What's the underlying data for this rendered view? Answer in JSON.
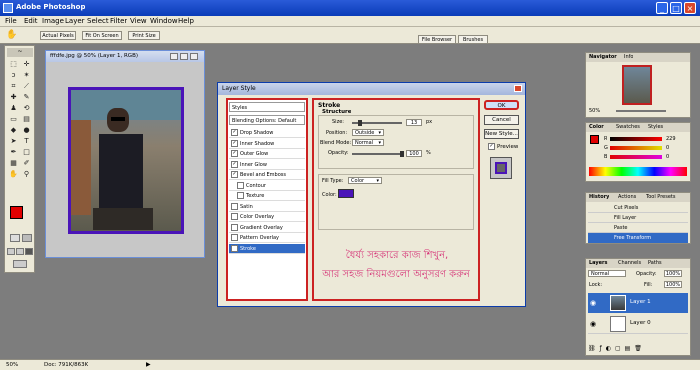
{
  "app": {
    "title": "Adobe Photoshop"
  },
  "menu": [
    "File",
    "Edit",
    "Image",
    "Layer",
    "Select",
    "Filter",
    "View",
    "Window",
    "Help"
  ],
  "options": {
    "buttons": [
      "Actual Pixels",
      "Fit On Screen",
      "Print Size"
    ],
    "right_tabs": [
      "File Browser",
      "Brushes"
    ]
  },
  "document": {
    "title": "fffdfe.jpg @ 50% (Layer 1, RGB)"
  },
  "dialog": {
    "title": "Layer Style",
    "styles_header": "Styles",
    "blending": "Blending Options: Default",
    "effects": [
      {
        "label": "Drop Shadow",
        "checked": true
      },
      {
        "label": "Inner Shadow",
        "checked": true
      },
      {
        "label": "Outer Glow",
        "checked": true
      },
      {
        "label": "Inner Glow",
        "checked": true
      },
      {
        "label": "Bevel and Emboss",
        "checked": true
      },
      {
        "label": "Contour",
        "checked": false
      },
      {
        "label": "Texture",
        "checked": false
      },
      {
        "label": "Satin",
        "checked": false
      },
      {
        "label": "Color Overlay",
        "checked": false
      },
      {
        "label": "Gradient Overlay",
        "checked": false
      },
      {
        "label": "Pattern Overlay",
        "checked": false
      },
      {
        "label": "Stroke",
        "checked": true
      }
    ],
    "stroke": {
      "heading": "Stroke",
      "structure": "Structure",
      "size_label": "Size:",
      "size_value": "13",
      "size_unit": "px",
      "position_label": "Position:",
      "position_value": "Outside",
      "blend_label": "Blend Mode:",
      "blend_value": "Normal",
      "opacity_label": "Opacity:",
      "opacity_value": "100",
      "opacity_unit": "%",
      "fill_type_label": "Fill Type:",
      "fill_type_value": "Color",
      "color_label": "Color:",
      "color_hex": "#4a14b8"
    },
    "buttons": {
      "ok": "OK",
      "cancel": "Cancel",
      "new_style": "New Style...",
      "preview": "Preview"
    },
    "bengali_line1": "ধৈর্য্য সহকারে কাজ শিখুন,",
    "bengali_line2": "আর সহজ নিয়মগুলো অনুসরণ করুন"
  },
  "navigator": {
    "tabs": [
      "Navigator",
      "Info"
    ],
    "zoom": "50%"
  },
  "color_panel": {
    "tabs": [
      "Color",
      "Swatches",
      "Styles"
    ],
    "r_label": "R",
    "g_label": "G",
    "b_label": "B",
    "r": "229",
    "g": "0",
    "b": "0"
  },
  "history": {
    "tabs": [
      "History",
      "Actions",
      "Tool Presets"
    ],
    "items": [
      "Cut Pixels",
      "Fill Layer",
      "Paste",
      "Free Transform"
    ]
  },
  "layers": {
    "tabs": [
      "Layers",
      "Channels",
      "Paths"
    ],
    "mode": "Normal",
    "opacity_label": "Opacity:",
    "opacity": "100%",
    "lock_label": "Lock:",
    "fill_label": "Fill:",
    "fill": "100%",
    "items": [
      "Layer 1",
      "Layer 0"
    ]
  },
  "status": {
    "zoom": "50%",
    "doc": "Doc: 791K/863K"
  }
}
